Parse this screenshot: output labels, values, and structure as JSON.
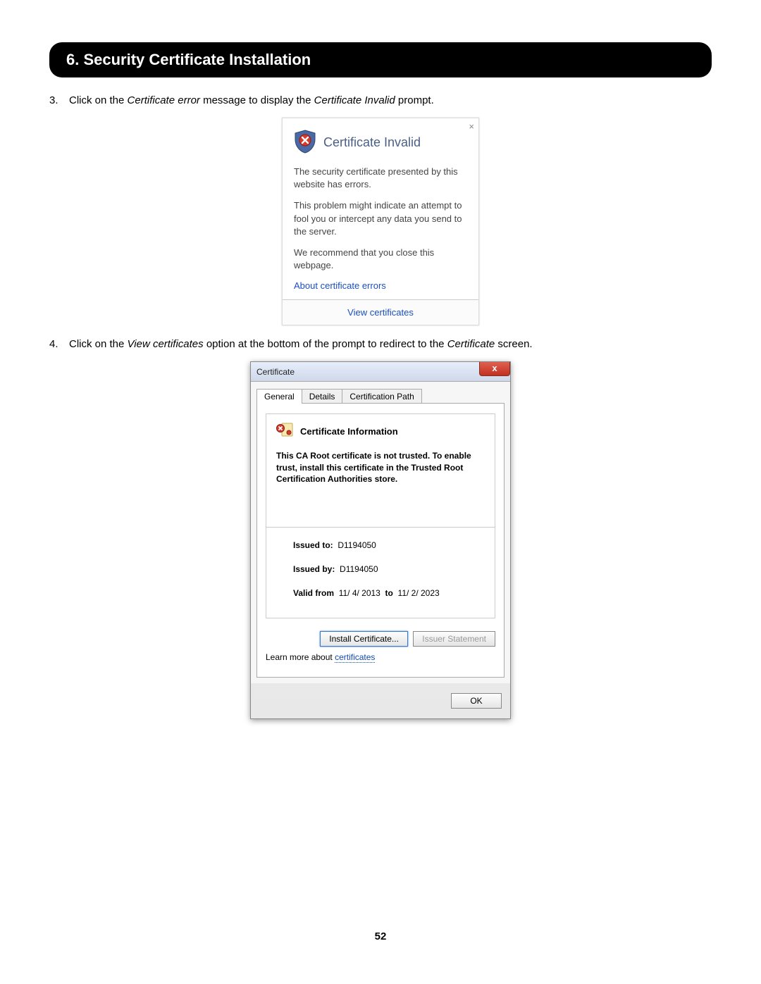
{
  "section": {
    "title": "6. Security Certificate Installation"
  },
  "steps": {
    "s3": {
      "num": "3.",
      "pre": "Click on the ",
      "em1": "Certificate error",
      "mid": " message to display the ",
      "em2": "Certificate Invalid",
      "post": " prompt."
    },
    "s4": {
      "num": "4.",
      "pre": "Click on the ",
      "em1": "View certificates",
      "mid": " option at the bottom of the prompt to redirect to the ",
      "em2": "Certificate",
      "post": " screen."
    }
  },
  "prompt": {
    "close": "×",
    "title": "Certificate Invalid",
    "p1": "The security certificate presented by this website has errors.",
    "p2": "This problem might indicate an attempt to fool you or intercept any data you send to the server.",
    "p3": "We recommend that you close this webpage.",
    "link": "About certificate errors",
    "view": "View certificates"
  },
  "dialog": {
    "title": "Certificate",
    "close": "x",
    "tabs": {
      "general": "General",
      "details": "Details",
      "path": "Certification Path"
    },
    "info_title": "Certificate Information",
    "trust_msg": "This CA Root certificate is not trusted. To enable trust, install this certificate in the Trusted Root Certification Authorities store.",
    "issued_to_label": "Issued to:",
    "issued_to": "D1194050",
    "issued_by_label": "Issued by:",
    "issued_by": "D1194050",
    "valid_from_label": "Valid from",
    "valid_from": "11/ 4/ 2013",
    "valid_to_label": "to",
    "valid_to": "11/ 2/ 2023",
    "install_btn": "Install Certificate...",
    "issuer_btn": "Issuer Statement",
    "learn_pre": "Learn more about ",
    "learn_link": "certificates",
    "ok": "OK"
  },
  "page_number": "52"
}
